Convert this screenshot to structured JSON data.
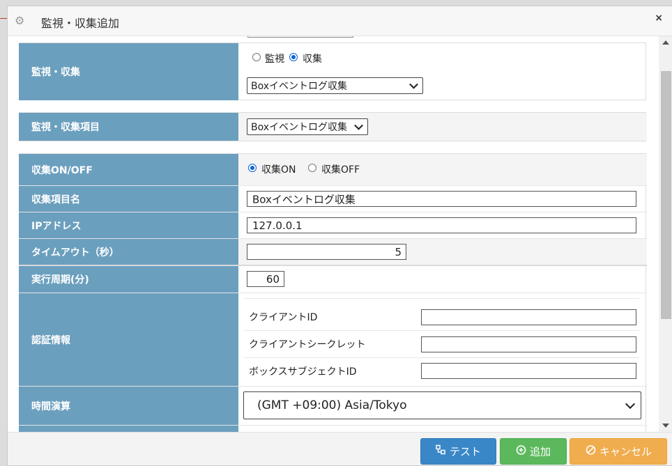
{
  "dialog": {
    "title": "監視・収集追加",
    "close": "×"
  },
  "rows": {
    "mode": {
      "label": "監視・収集",
      "options": [
        "監視",
        "収集"
      ],
      "selected": "収集",
      "select_value": "Boxイベントログ収集"
    },
    "item": {
      "label": "監視・収集項目",
      "select_value": "Boxイベントログ収集"
    },
    "onoff": {
      "label": "収集ON/OFF",
      "options": [
        "収集ON",
        "収集OFF"
      ],
      "selected": "収集ON"
    },
    "name": {
      "label": "収集項目名",
      "value": "Boxイベントログ収集"
    },
    "ip": {
      "label": "IPアドレス",
      "value": "127.0.0.1"
    },
    "timeout": {
      "label": "タイムアウト（秒）",
      "value": "5"
    },
    "period": {
      "label": "実行周期(分)",
      "value": "60"
    },
    "auth": {
      "label": "認証情報",
      "fields": [
        {
          "label": "クライアントID",
          "value": ""
        },
        {
          "label": "クライアントシークレット",
          "value": ""
        },
        {
          "label": "ボックスサブジェクトID",
          "value": ""
        }
      ]
    },
    "tz": {
      "label": "時間演算",
      "select_value": "(GMT +09:00) Asia/Tokyo"
    }
  },
  "footer": {
    "test_label": "テスト",
    "add_label": "追加",
    "cancel_label": "キャンセル"
  },
  "colors": {
    "label_bg": "#6b9fbe",
    "test_btn": "#3a87c8",
    "add_btn": "#5cb85c",
    "cancel_btn": "#f0ad4e",
    "radio_selected": "#0a64d8"
  },
  "icons": {
    "title": "gear-icon",
    "close": "close-icon",
    "test": "network-icon",
    "add": "plus-circle-icon",
    "cancel": "ban-icon"
  }
}
